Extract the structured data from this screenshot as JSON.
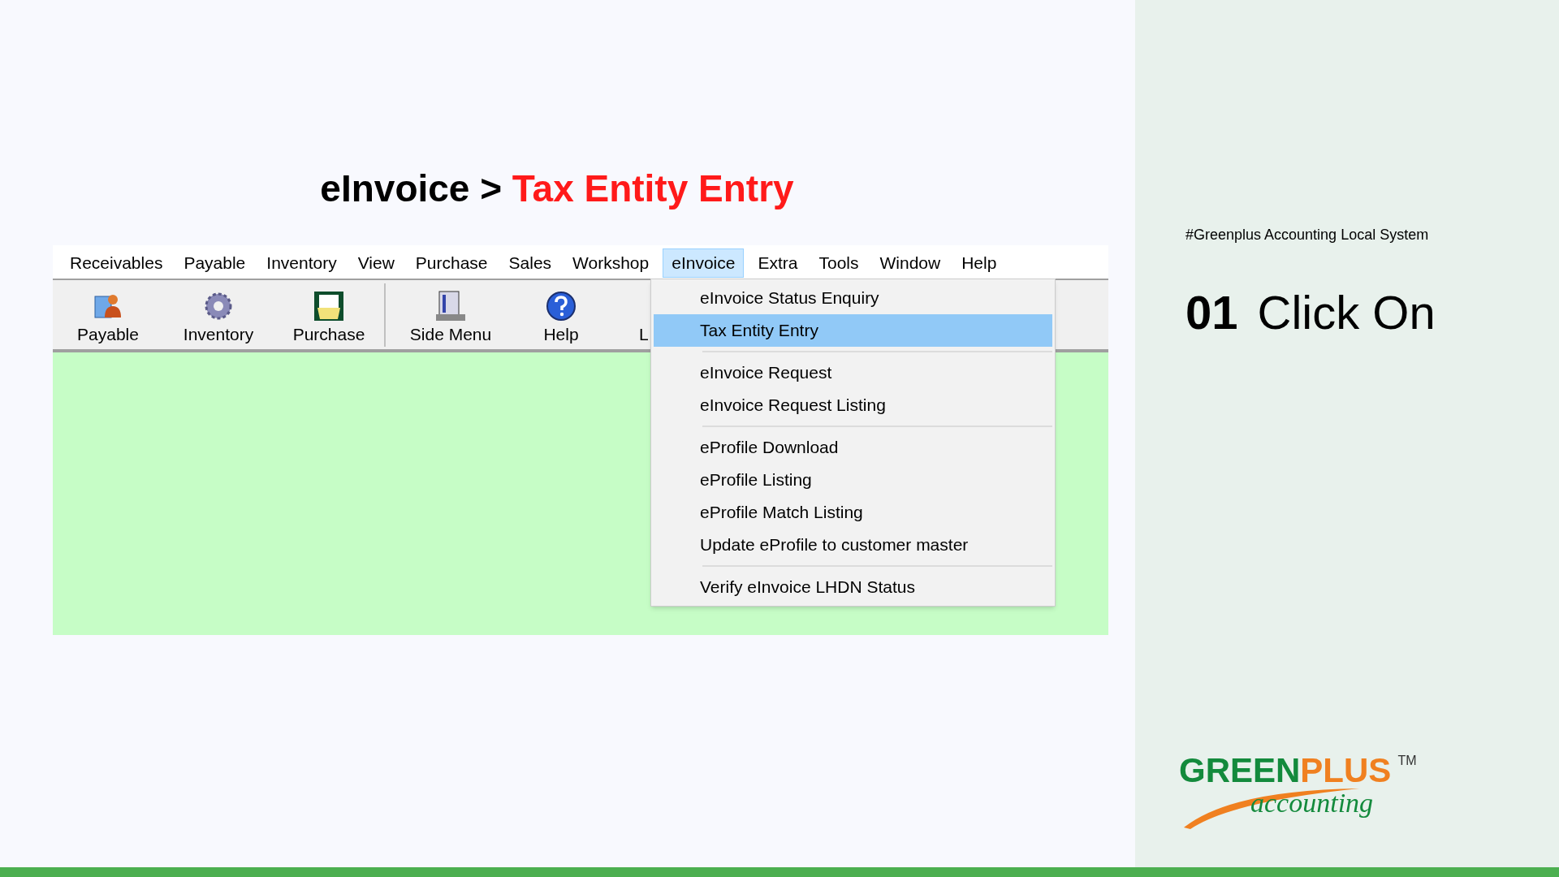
{
  "slide": {
    "title": {
      "prefix": "eInvoice >",
      "highlight": "Tax Entity Entry"
    }
  },
  "app": {
    "menu_bar": [
      {
        "label": "Receivables",
        "selected": false
      },
      {
        "label": "Payable",
        "selected": false
      },
      {
        "label": "Inventory",
        "selected": false
      },
      {
        "label": "View",
        "selected": false
      },
      {
        "label": "Purchase",
        "selected": false
      },
      {
        "label": "Sales",
        "selected": false
      },
      {
        "label": "Workshop",
        "selected": false
      },
      {
        "label": "eInvoice",
        "selected": true
      },
      {
        "label": "Extra",
        "selected": false
      },
      {
        "label": "Tools",
        "selected": false
      },
      {
        "label": "Window",
        "selected": false
      },
      {
        "label": "Help",
        "selected": false
      }
    ],
    "toolbar_groups": [
      [
        {
          "label": "Payable",
          "kind": "people"
        },
        {
          "label": "Inventory",
          "kind": "gear"
        },
        {
          "label": "Purchase",
          "kind": "document"
        }
      ],
      [
        {
          "label": "Side Menu",
          "kind": "list"
        },
        {
          "label": "Help",
          "kind": "help"
        },
        {
          "label": "L",
          "kind": "text"
        }
      ]
    ],
    "dropdown": {
      "sections": [
        [
          {
            "label": "eInvoice Status Enquiry",
            "selected": false
          },
          {
            "label": "Tax Entity Entry",
            "selected": true
          }
        ],
        [
          {
            "label": "eInvoice Request",
            "selected": false
          },
          {
            "label": "eInvoice Request Listing",
            "selected": false
          }
        ],
        [
          {
            "label": "eProfile Download",
            "selected": false
          },
          {
            "label": "eProfile Listing",
            "selected": false
          },
          {
            "label": "eProfile Match Listing",
            "selected": false
          },
          {
            "label": "Update eProfile to customer master",
            "selected": false
          }
        ],
        [
          {
            "label": "Verify eInvoice LHDN Status",
            "selected": false
          }
        ]
      ]
    }
  },
  "side_panel": {
    "tag": "#Greenplus Accounting Local System",
    "step_number": "01",
    "step_text": "Click On",
    "logo": {
      "word1": "GREEN",
      "word2": "PLUS",
      "trademark": "TM",
      "tagline": "accounting"
    }
  }
}
